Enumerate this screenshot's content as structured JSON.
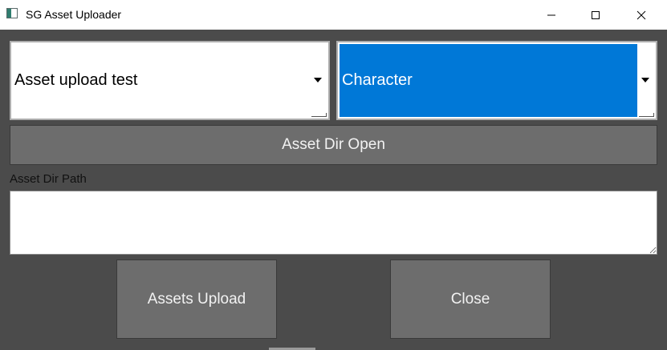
{
  "window": {
    "title": "SG Asset Uploader",
    "icon": "app-window-icon",
    "controls": [
      "minimize-icon",
      "maximize-icon",
      "close-icon"
    ]
  },
  "combos": {
    "project": {
      "value": "Asset upload test"
    },
    "category": {
      "value": "Character",
      "highlight_color": "#0078d7"
    }
  },
  "buttons": {
    "asset_dir_open": "Asset Dir Open",
    "assets_upload": "Assets Upload",
    "close": "Close"
  },
  "path": {
    "label": "Asset Dir Path",
    "value": ""
  },
  "colors": {
    "background": "#4b4b4b",
    "button": "#6d6d6d",
    "accent": "#0078d7"
  }
}
